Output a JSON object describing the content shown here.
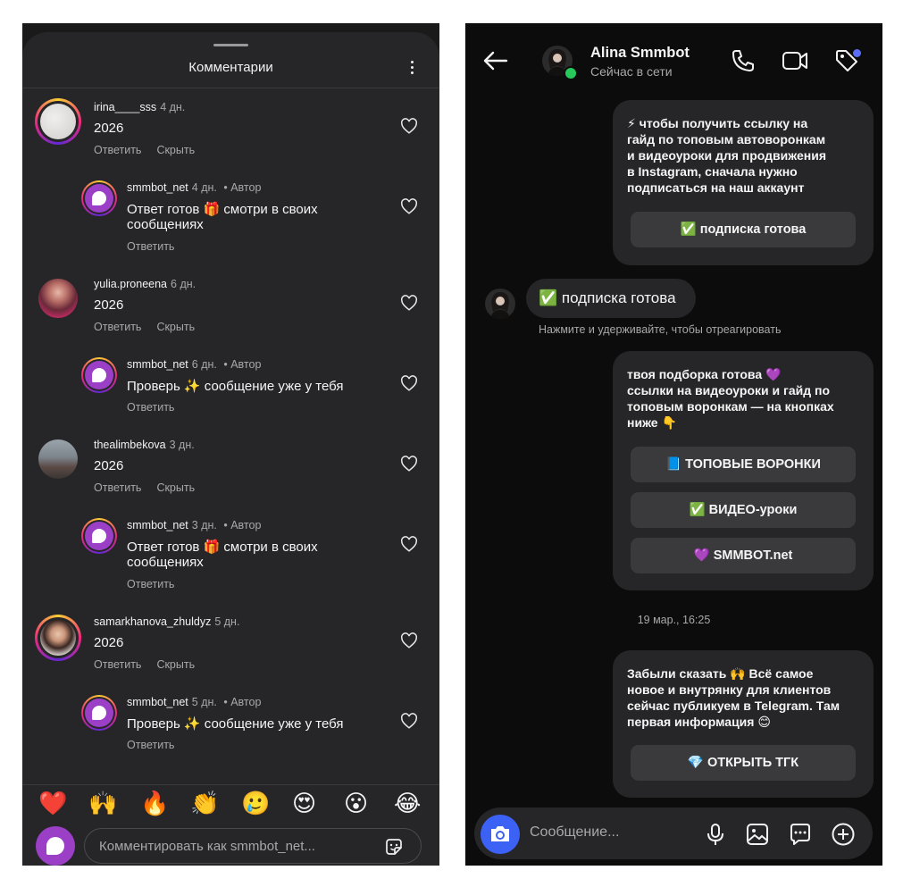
{
  "comments_panel": {
    "title": "Комментарии",
    "threads": [
      {
        "comment": {
          "username": "irina____sss",
          "age": "4 дн.",
          "text": "2026",
          "reply_label": "Ответить",
          "hide_label": "Скрыть"
        },
        "reply": {
          "username": "smmbot_net",
          "age": "4 дн.",
          "author_badge": "• Автор",
          "text": "Ответ готов 🎁 смотри в своих сообщениях",
          "reply_label": "Ответить"
        }
      },
      {
        "comment": {
          "username": "yulia.proneena",
          "age": "6 дн.",
          "text": "2026",
          "reply_label": "Ответить",
          "hide_label": "Скрыть"
        },
        "reply": {
          "username": "smmbot_net",
          "age": "6 дн.",
          "author_badge": "• Автор",
          "text": "Проверь ✨ сообщение уже у тебя",
          "reply_label": "Ответить"
        }
      },
      {
        "comment": {
          "username": "thealimbekova",
          "age": "3 дн.",
          "text": "2026",
          "reply_label": "Ответить",
          "hide_label": "Скрыть"
        },
        "reply": {
          "username": "smmbot_net",
          "age": "3 дн.",
          "author_badge": "• Автор",
          "text": "Ответ готов 🎁 смотри в своих сообщениях",
          "reply_label": "Ответить"
        }
      },
      {
        "comment": {
          "username": "samarkhanova_zhuldyz",
          "age": "5 дн.",
          "text": "2026",
          "reply_label": "Ответить",
          "hide_label": "Скрыть"
        },
        "reply": {
          "username": "smmbot_net",
          "age": "5 дн.",
          "author_badge": "• Автор",
          "text": "Проверь ✨ сообщение уже у тебя",
          "reply_label": "Ответить"
        }
      }
    ],
    "quick_reactions": [
      "❤️",
      "🙌",
      "🔥",
      "👏",
      "🥲",
      "😍",
      "😮",
      "😂"
    ],
    "comment_placeholder": "Комментировать как smmbot_net..."
  },
  "chat_panel": {
    "contact_name": "Alina Smmbot",
    "contact_status": "Сейчас в сети",
    "messages": [
      {
        "lines": [
          "⚡ чтобы получить ссылку на",
          "гайд по топовым автоворонкам",
          "и видеоуроки для продвижения",
          "в Instagram, сначала нужно",
          "подписаться на наш аккаунт"
        ],
        "buttons": [
          "✅ подписка готова"
        ]
      },
      {
        "incoming_text": "✅ подписка готова",
        "hint": "Нажмите и удерживайте, чтобы отреагировать"
      },
      {
        "lines": [
          "твоя подборка готова 💜",
          "ссылки на видеоуроки и гайд по",
          "топовым воронкам — на кнопках",
          "ниже 👇"
        ],
        "buttons": [
          "📘 ТОПОВЫЕ ВОРОНКИ",
          "✅ ВИДЕО-уроки",
          "💜 SMMBOT.net"
        ]
      },
      {
        "timestamp": "19 мар., 16:25"
      },
      {
        "lines": [
          "Забыли сказать 🙌 Всё самое",
          "новое и внутрянку для клиентов",
          "сейчас публикуем в Telegram. Там",
          "первая информация 😊"
        ],
        "buttons": [
          "💎 ОТКРЫТЬ ТГК"
        ]
      }
    ],
    "message_placeholder": "Сообщение..."
  }
}
